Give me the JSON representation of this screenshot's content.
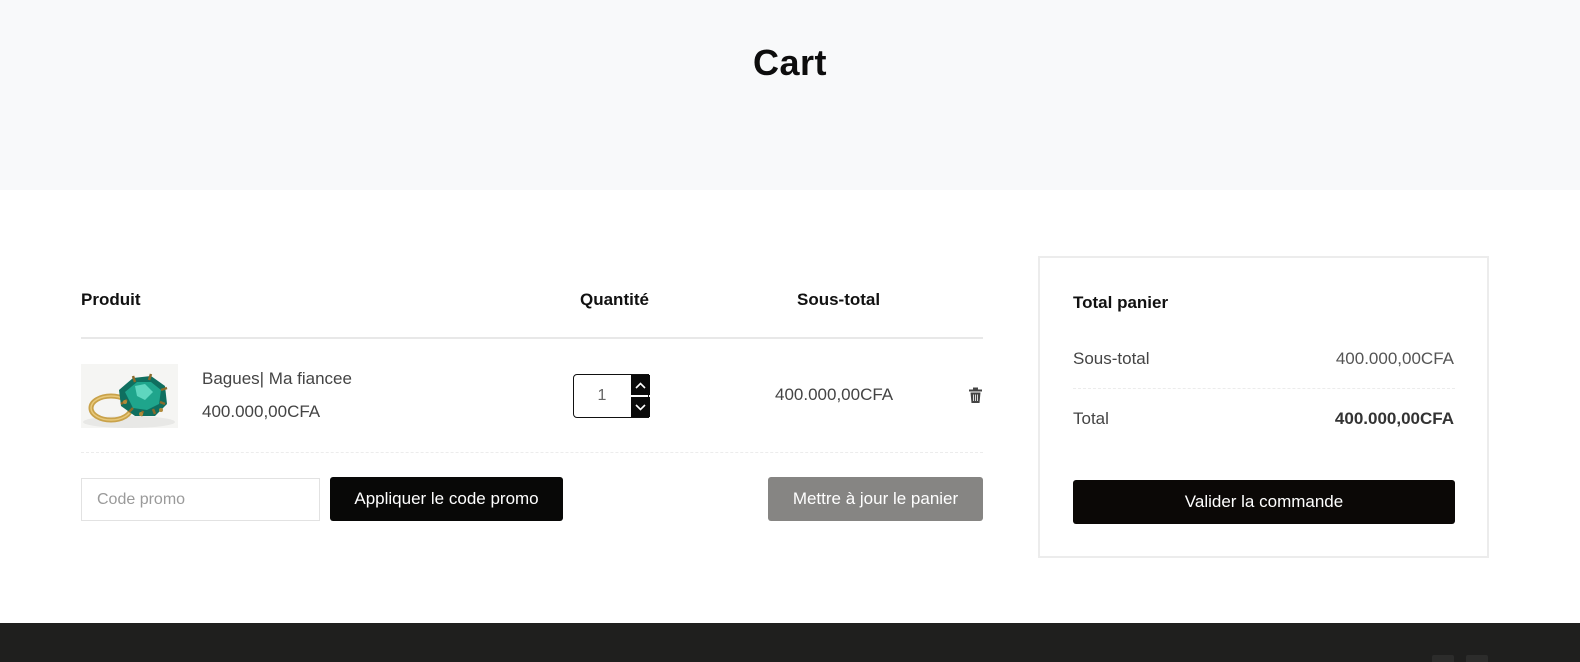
{
  "page": {
    "title": "Cart"
  },
  "cart": {
    "headers": {
      "product": "Produit",
      "quantity": "Quantité",
      "subtotal": "Sous-total"
    },
    "items": [
      {
        "name": "Bagues| Ma fiancee",
        "price": "400.000,00CFA",
        "quantity": "1",
        "subtotal": "400.000,00CFA",
        "image_icon": "ring-product-image"
      }
    ],
    "promo": {
      "placeholder": "Code promo",
      "apply_label": "Appliquer le code promo"
    },
    "update_label": "Mettre à jour le panier"
  },
  "totals": {
    "title": "Total panier",
    "subtotal_label": "Sous-total",
    "subtotal_value": "400.000,00CFA",
    "total_label": "Total",
    "total_value": "400.000,00CFA",
    "checkout_label": "Valider la commande"
  },
  "colors": {
    "hero_bg": "#f8f9fa",
    "primary_button": "#080807",
    "update_button": "#868583",
    "footer_bg": "#1f1f1e"
  }
}
